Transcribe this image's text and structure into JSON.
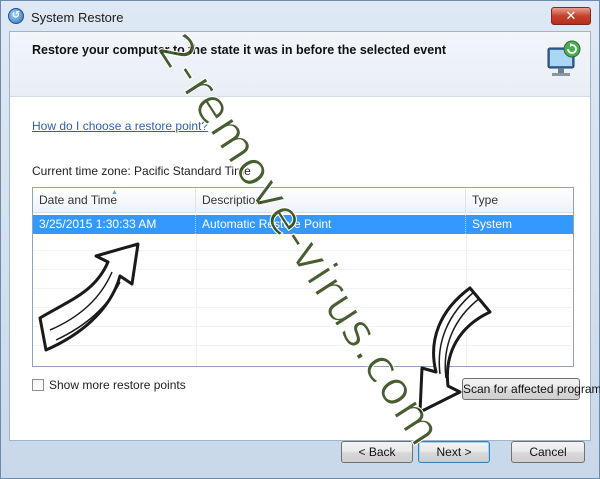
{
  "window": {
    "title": "System Restore",
    "close_symbol": "✕",
    "icon": "system-restore-icon"
  },
  "heading": "Restore your computer to the state it was in before the selected event",
  "help_link": "How do I choose a restore point?",
  "timezone": "Current time zone: Pacific Standard Time",
  "table": {
    "columns": [
      "Date and Time",
      "Description",
      "Type"
    ],
    "rows": [
      {
        "date": "3/25/2015 1:30:33 AM",
        "description": "Automatic Restore Point",
        "type": "System",
        "selected": true
      }
    ]
  },
  "show_more_label": "Show more restore points",
  "show_more_checked": false,
  "scan_button": "Scan for affected programs",
  "buttons": {
    "back": "< Back",
    "next": "Next >",
    "cancel": "Cancel"
  },
  "watermark": "2-remove-virus.com",
  "colors": {
    "selection": "#3399ff",
    "link": "#2e5fb0",
    "watermark": "#2e4814"
  }
}
